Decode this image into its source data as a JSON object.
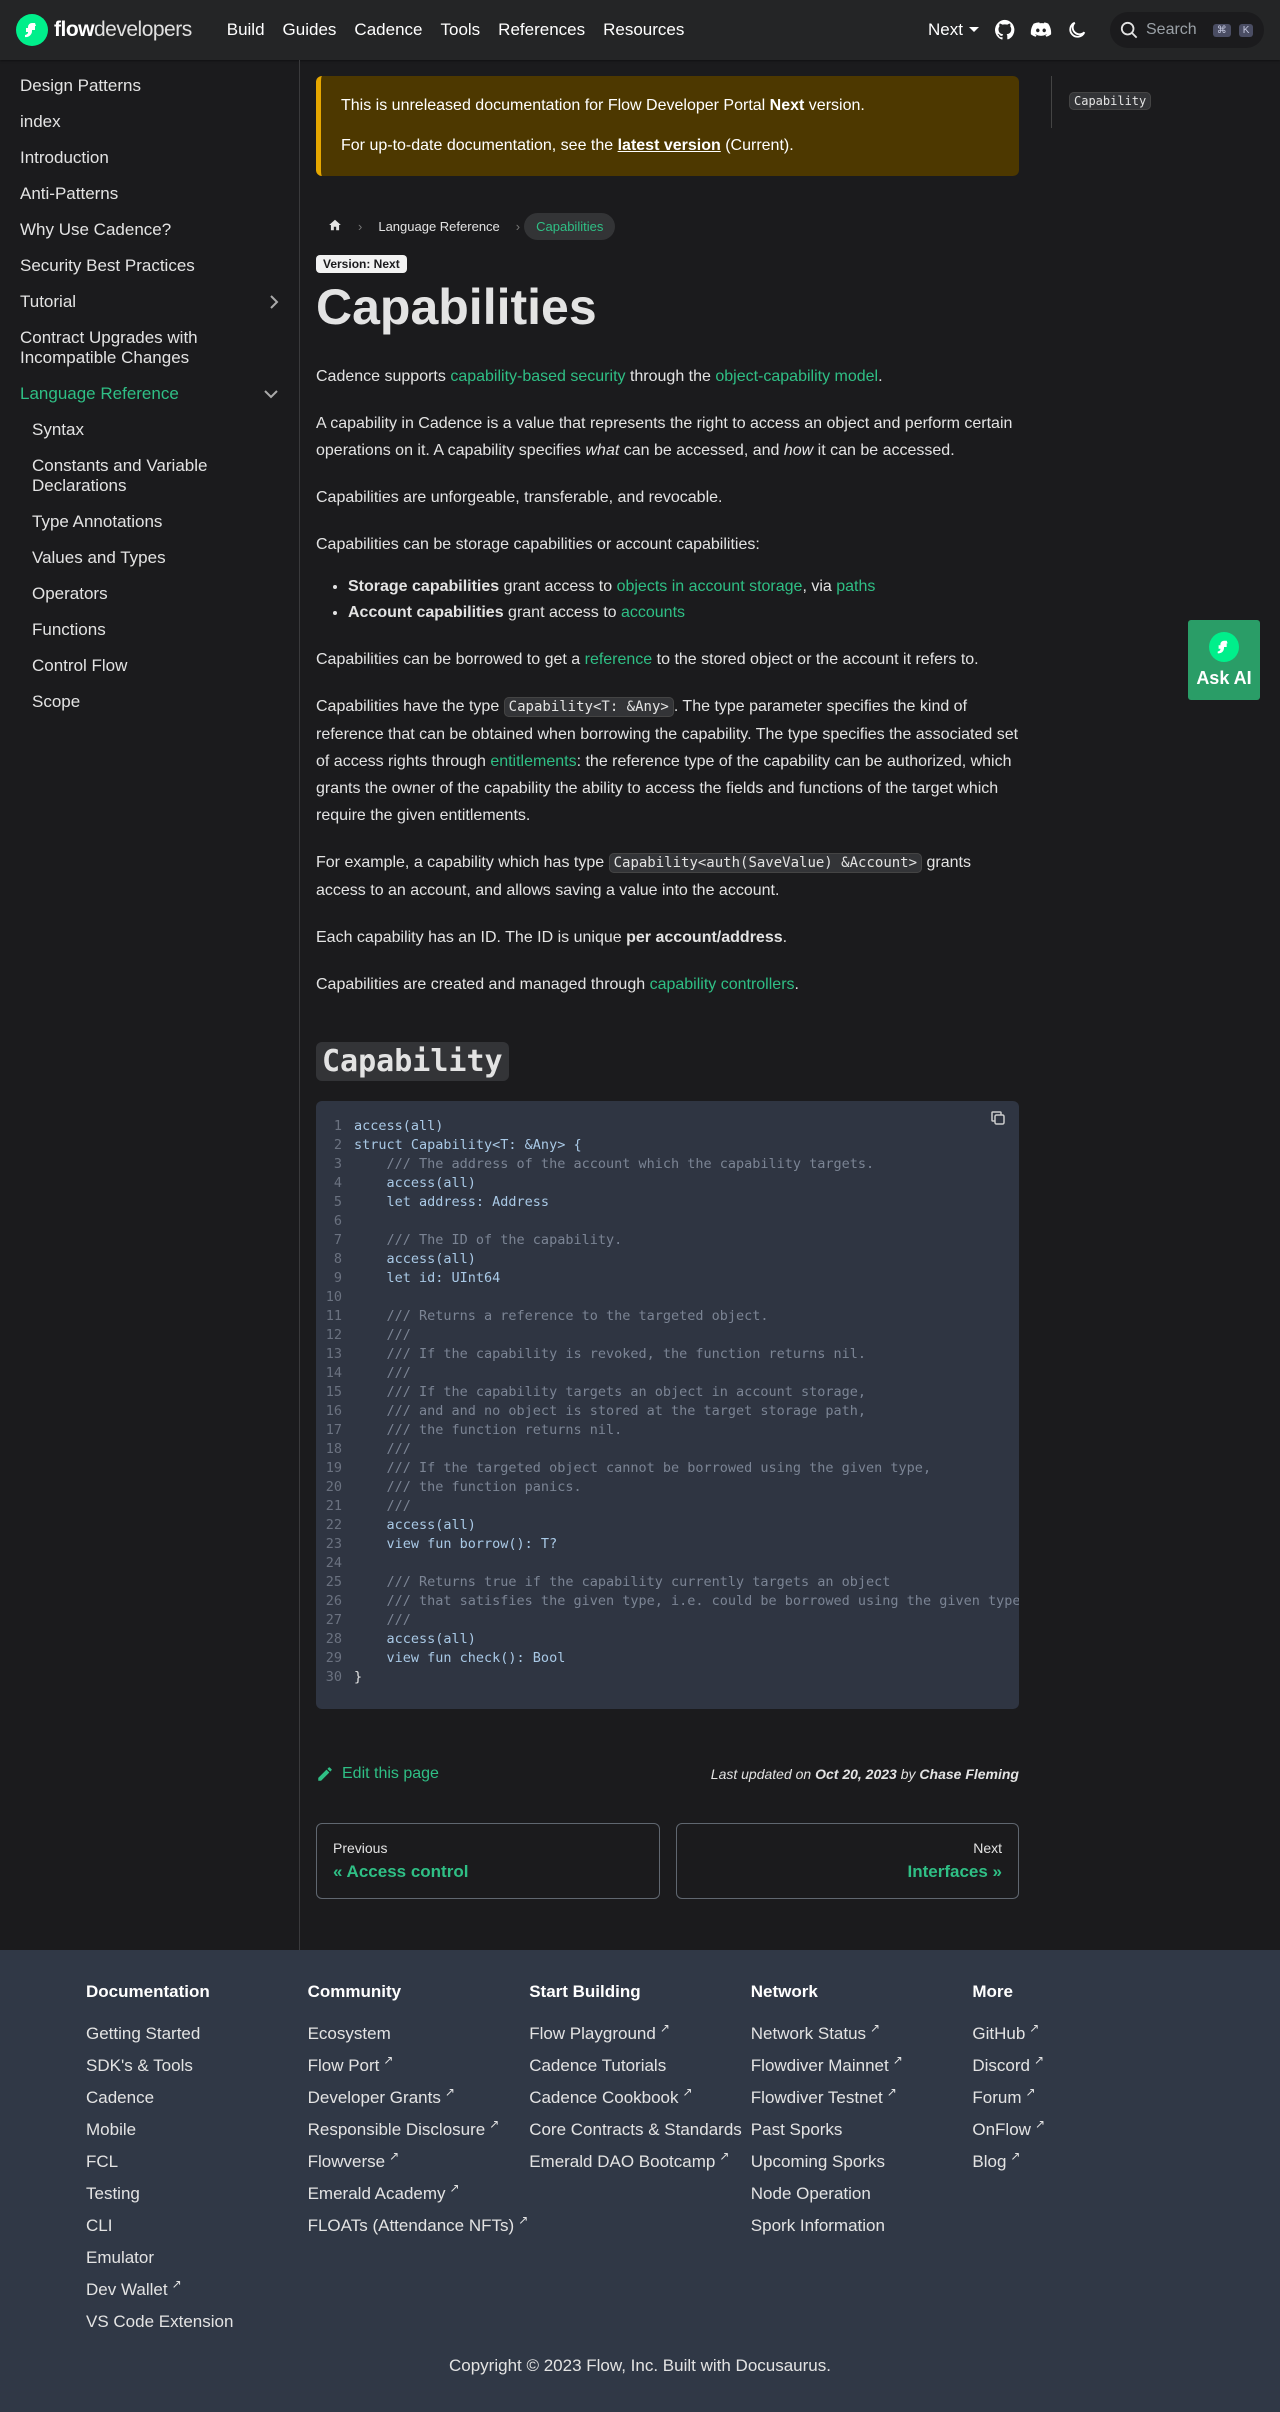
{
  "navbar": {
    "logo_bold": "flow",
    "logo_rest": "developers",
    "links": [
      "Build",
      "Guides",
      "Cadence",
      "Tools",
      "References",
      "Resources"
    ],
    "version": "Next",
    "search_placeholder": "Search",
    "kbd_cmd": "⌘",
    "kbd_k": "K"
  },
  "sidebar": {
    "items": [
      {
        "label": "Design Patterns"
      },
      {
        "label": "index"
      },
      {
        "label": "Introduction"
      },
      {
        "label": "Anti-Patterns"
      },
      {
        "label": "Why Use Cadence?"
      },
      {
        "label": "Security Best Practices"
      },
      {
        "label": "Tutorial"
      },
      {
        "label": "Contract Upgrades with Incompatible Changes"
      },
      {
        "label": "Language Reference"
      }
    ],
    "sub_items": [
      "Syntax",
      "Constants and Variable Declarations",
      "Type Annotations",
      "Values and Types",
      "Operators",
      "Functions",
      "Control Flow",
      "Scope"
    ]
  },
  "banner": {
    "line1_pre": "This is unreleased documentation for Flow Developer Portal ",
    "line1_bold": "Next",
    "line1_post": " version.",
    "line2_pre": "For up-to-date documentation, see the ",
    "line2_link": "latest version",
    "line2_post": " (Current)."
  },
  "breadcrumb": {
    "section": "Language Reference",
    "current": "Capabilities"
  },
  "version_badge": "Version: Next",
  "title": "Capabilities",
  "content": {
    "p1_pre": "Cadence supports ",
    "p1_link1": "capability-based security",
    "p1_mid": " through the ",
    "p1_link2": "object-capability model",
    "p1_post": ".",
    "p2_pre": "A capability in Cadence is a value that represents the right to access an object and perform certain operations on it. A capability specifies ",
    "p2_em1": "what",
    "p2_mid": " can be accessed, and ",
    "p2_em2": "how",
    "p2_post": " it can be accessed.",
    "p3": "Capabilities are unforgeable, transferable, and revocable.",
    "p4": "Capabilities can be storage capabilities or account capabilities:",
    "li1_bold": "Storage capabilities",
    "li1_pre": " grant access to ",
    "li1_link1": "objects in account storage",
    "li1_mid": ", via ",
    "li1_link2": "paths",
    "li2_bold": "Account capabilities",
    "li2_pre": " grant access to ",
    "li2_link": "accounts",
    "p5_pre": "Capabilities can be borrowed to get a ",
    "p5_link": "reference",
    "p5_post": " to the stored object or the account it refers to.",
    "p6_pre": "Capabilities have the type ",
    "p6_code": "Capability<T: &Any>",
    "p6_mid": ". The type parameter specifies the kind of reference that can be obtained when borrowing the capability. The type specifies the associated set of access rights through ",
    "p6_link": "entitlements",
    "p6_post": ": the reference type of the capability can be authorized, which grants the owner of the capability the ability to access the fields and functions of the target which require the given entitlements.",
    "p7_pre": "For example, a capability which has type ",
    "p7_code": "Capability<auth(SaveValue) &Account>",
    "p7_post": " grants access to an account, and allows saving a value into the account.",
    "p8_pre": "Each capability has an ID. The ID is unique ",
    "p8_bold": "per account/address",
    "p8_post": ".",
    "p9_pre": "Capabilities are created and managed through ",
    "p9_link": "capability controllers",
    "p9_post": ".",
    "h2": "Capability"
  },
  "code_lines": [
    "access(all)",
    "struct Capability<T: &Any> {",
    "    /// The address of the account which the capability targets.",
    "    access(all)",
    "    let address: Address",
    "",
    "    /// The ID of the capability.",
    "    access(all)",
    "    let id: UInt64",
    "",
    "    /// Returns a reference to the targeted object.",
    "    ///",
    "    /// If the capability is revoked, the function returns nil.",
    "    ///",
    "    /// If the capability targets an object in account storage,",
    "    /// and and no object is stored at the target storage path,",
    "    /// the function returns nil.",
    "    ///",
    "    /// If the targeted object cannot be borrowed using the given type,",
    "    /// the function panics.",
    "    ///",
    "    access(all)",
    "    view fun borrow(): T?",
    "",
    "    /// Returns true if the capability currently targets an object",
    "    /// that satisfies the given type, i.e. could be borrowed using the given type.",
    "    ///",
    "    access(all)",
    "    view fun check(): Bool",
    "}"
  ],
  "edit": {
    "label": "Edit this page",
    "updated_pre": "Last updated on ",
    "updated_date": "Oct 20, 2023",
    "updated_by": " by ",
    "updated_author": "Chase Fleming"
  },
  "pager": {
    "prev_sub": "Previous",
    "prev_label": "« Access control",
    "next_sub": "Next",
    "next_label": "Interfaces »"
  },
  "toc": {
    "item": "Capability"
  },
  "ask_ai": "Ask AI",
  "footer": {
    "columns": [
      {
        "title": "Documentation",
        "links": [
          {
            "label": "Getting Started",
            "ext": false
          },
          {
            "label": "SDK's & Tools",
            "ext": false
          },
          {
            "label": "Cadence",
            "ext": false
          },
          {
            "label": "Mobile",
            "ext": false
          },
          {
            "label": "FCL",
            "ext": false
          },
          {
            "label": "Testing",
            "ext": false
          },
          {
            "label": "CLI",
            "ext": false
          },
          {
            "label": "Emulator",
            "ext": false
          },
          {
            "label": "Dev Wallet",
            "ext": true
          },
          {
            "label": "VS Code Extension",
            "ext": false
          }
        ]
      },
      {
        "title": "Community",
        "links": [
          {
            "label": "Ecosystem",
            "ext": false
          },
          {
            "label": "Flow Port",
            "ext": true
          },
          {
            "label": "Developer Grants",
            "ext": true
          },
          {
            "label": "Responsible Disclosure",
            "ext": true
          },
          {
            "label": "Flowverse",
            "ext": true
          },
          {
            "label": "Emerald Academy",
            "ext": true
          },
          {
            "label": "FLOATs (Attendance NFTs)",
            "ext": true
          }
        ]
      },
      {
        "title": "Start Building",
        "links": [
          {
            "label": "Flow Playground",
            "ext": true
          },
          {
            "label": "Cadence Tutorials",
            "ext": false
          },
          {
            "label": "Cadence Cookbook",
            "ext": true
          },
          {
            "label": "Core Contracts & Standards",
            "ext": false
          },
          {
            "label": "Emerald DAO Bootcamp",
            "ext": true
          }
        ]
      },
      {
        "title": "Network",
        "links": [
          {
            "label": "Network Status",
            "ext": true
          },
          {
            "label": "Flowdiver Mainnet",
            "ext": true
          },
          {
            "label": "Flowdiver Testnet",
            "ext": true
          },
          {
            "label": "Past Sporks",
            "ext": false
          },
          {
            "label": "Upcoming Sporks",
            "ext": false
          },
          {
            "label": "Node Operation",
            "ext": false
          },
          {
            "label": "Spork Information",
            "ext": false
          }
        ]
      },
      {
        "title": "More",
        "links": [
          {
            "label": "GitHub",
            "ext": true
          },
          {
            "label": "Discord",
            "ext": true
          },
          {
            "label": "Forum",
            "ext": true
          },
          {
            "label": "OnFlow",
            "ext": true
          },
          {
            "label": "Blog",
            "ext": true
          }
        ]
      }
    ],
    "copyright": "Copyright © 2023 Flow, Inc. Built with Docusaurus."
  },
  "colors": {
    "accent": "#2fbf85",
    "brand": "#00ef8b",
    "banner_bg": "#4d3800",
    "banner_border": "#e6a700"
  }
}
